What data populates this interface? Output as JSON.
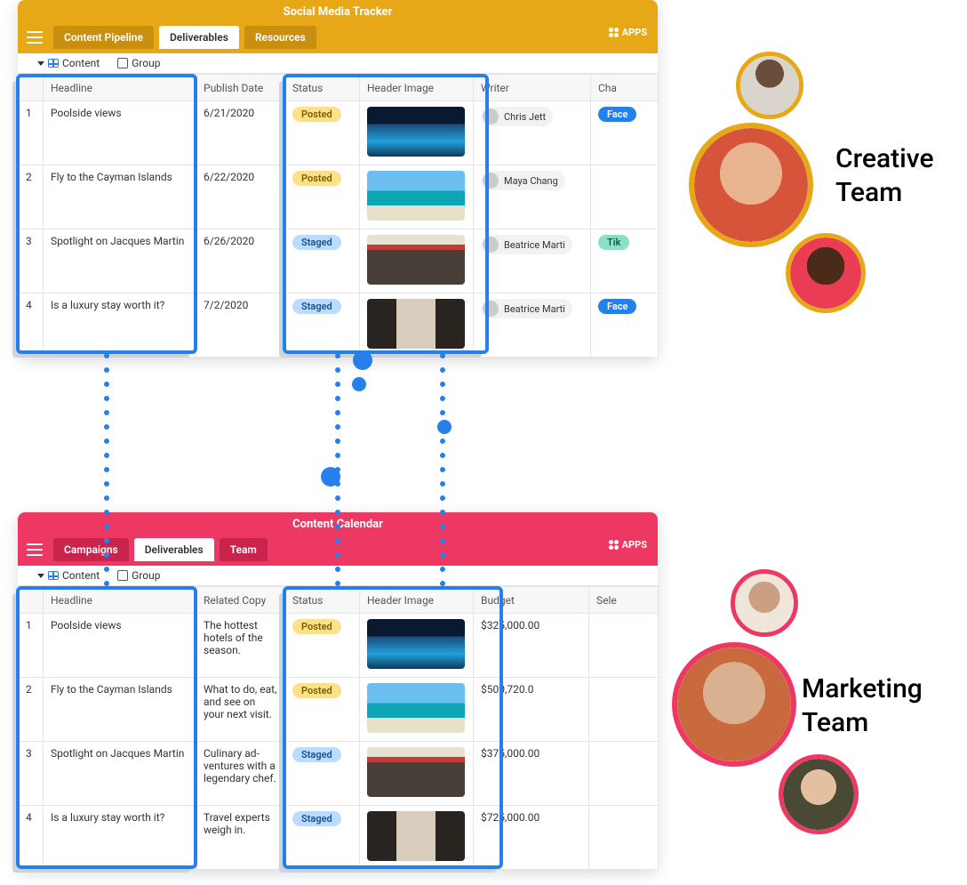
{
  "team_labels": {
    "creative": "Creative Team",
    "marketing": "Marketing Team"
  },
  "boards": {
    "top": {
      "title": "Social Media Tracker",
      "apps_label": "APPS",
      "tabs": [
        {
          "label": "Content Pipeline"
        },
        {
          "label": "Deliverables"
        },
        {
          "label": "Resources"
        }
      ],
      "views": {
        "content": "Content",
        "group": "Group"
      },
      "columns": [
        "",
        "Headline",
        "Publish Date",
        "Status",
        "Header Image",
        "Writer",
        "Cha"
      ],
      "rows": [
        {
          "n": "1",
          "headline": "Poolside views",
          "date": "6/21/2020",
          "status": "Posted",
          "thumb": "pool",
          "writer": "Chris Jett",
          "chan": "Face"
        },
        {
          "n": "2",
          "headline": "Fly to the Cayman Islands",
          "date": "6/22/2020",
          "status": "Posted",
          "thumb": "beach",
          "writer": "Maya Chang",
          "chan": ""
        },
        {
          "n": "3",
          "headline": "Spotlight on Jacques Martin",
          "date": "6/26/2020",
          "status": "Staged",
          "thumb": "cafe",
          "writer": "Beatrice Marti",
          "chan": "Tik"
        },
        {
          "n": "4",
          "headline": "Is a luxury stay worth it?",
          "date": "7/2/2020",
          "status": "Staged",
          "thumb": "lobby",
          "writer": "Beatrice Marti",
          "chan": "Face"
        }
      ]
    },
    "bottom": {
      "title": "Content Calendar",
      "apps_label": "APPS",
      "tabs": [
        {
          "label": "Campaigns"
        },
        {
          "label": "Deliverables"
        },
        {
          "label": "Team"
        }
      ],
      "views": {
        "content": "Content",
        "group": "Group"
      },
      "columns": [
        "",
        "Headline",
        "Related Copy",
        "Status",
        "Header Image",
        "Budget",
        "Sele"
      ],
      "rows": [
        {
          "n": "1",
          "headline": "Poolside views",
          "copy": "The hottest hotels of the season.",
          "status": "Posted",
          "thumb": "pool",
          "budget": "$325,000.00"
        },
        {
          "n": "2",
          "headline": "Fly to the Cayman Islands",
          "copy": "What to do, eat, and see on your next visit.",
          "status": "Posted",
          "thumb": "beach",
          "budget": "$500,720.0"
        },
        {
          "n": "3",
          "headline": "Spotlight on Jacques Martin",
          "copy": "Culinary ad-ventures with a legendary chef.",
          "status": "Staged",
          "thumb": "cafe",
          "budget": "$375,000.00"
        },
        {
          "n": "4",
          "headline": "Is a luxury stay worth it?",
          "copy": "Travel experts weigh in.",
          "status": "Staged",
          "thumb": "lobby",
          "budget": "$725,000.00"
        }
      ]
    }
  }
}
